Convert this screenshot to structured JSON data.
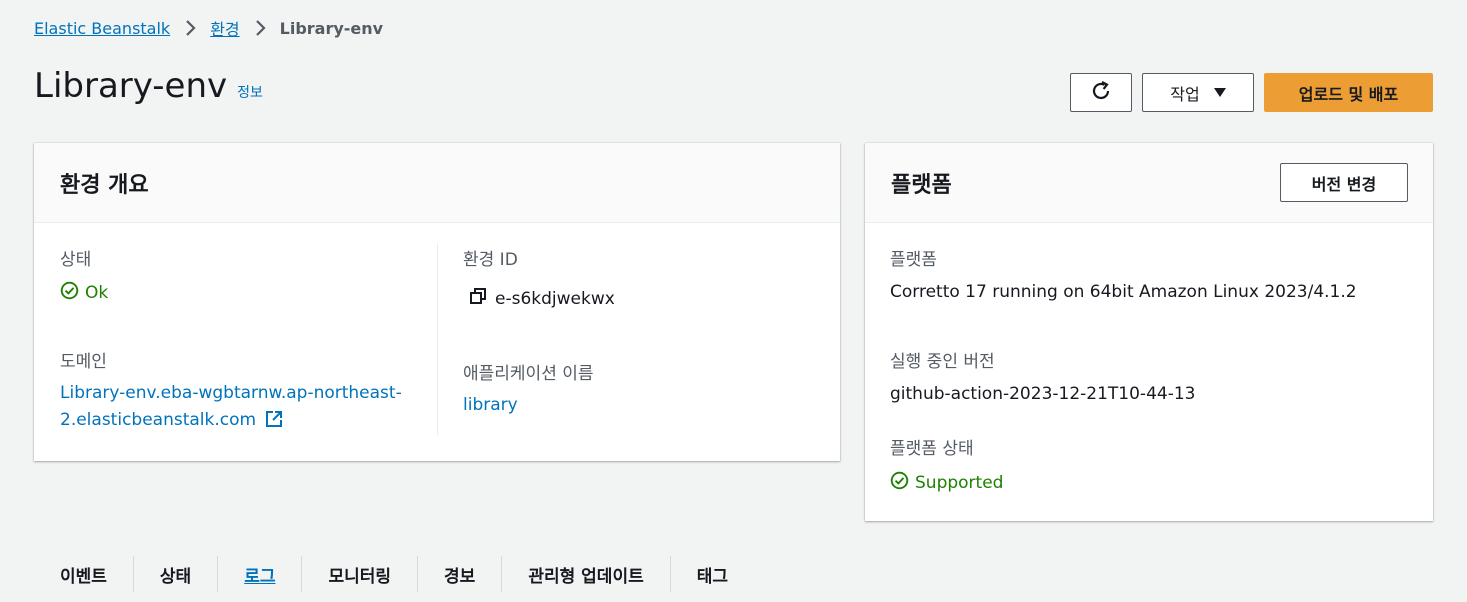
{
  "breadcrumb": {
    "items": [
      "Elastic Beanstalk",
      "환경"
    ],
    "current": "Library-env"
  },
  "header": {
    "title": "Library-env",
    "info_label": "정보",
    "actions_label": "작업",
    "deploy_label": "업로드 및 배포"
  },
  "overview": {
    "title": "환경 개요",
    "status_label": "상태",
    "status_value": "Ok",
    "domain_label": "도메인",
    "domain_line1": "Library-env.eba-wgbtarnw.ap-northeast-",
    "domain_line2": "2.elasticbeanstalk.com",
    "env_id_label": "환경 ID",
    "env_id_value": "e-s6kdjwekwx",
    "app_name_label": "애플리케이션 이름",
    "app_name_value": "library"
  },
  "platform": {
    "title": "플랫폼",
    "change_version_label": "버전 변경",
    "platform_label": "플랫폼",
    "platform_value": "Corretto 17 running on 64bit Amazon Linux 2023/4.1.2",
    "running_version_label": "실행 중인 버전",
    "running_version_value": "github-action-2023-12-21T10-44-13",
    "platform_status_label": "플랫폼 상태",
    "platform_status_value": "Supported"
  },
  "tabs": [
    {
      "label": "이벤트"
    },
    {
      "label": "상태"
    },
    {
      "label": "로그"
    },
    {
      "label": "모니터링"
    },
    {
      "label": "경보"
    },
    {
      "label": "관리형 업데이트"
    },
    {
      "label": "태그"
    }
  ],
  "active_tab": "로그",
  "colors": {
    "link": "#0073bb",
    "success": "#1d8102",
    "primary_button": "#ec9e35",
    "background": "#f2f3f3"
  },
  "icons": {
    "refresh": "refresh-icon",
    "dropdown": "caret-down-icon",
    "copy": "copy-icon",
    "external_link": "external-link-icon",
    "status_ok": "check-circle-icon",
    "breadcrumb_separator": "chevron-right-icon"
  }
}
